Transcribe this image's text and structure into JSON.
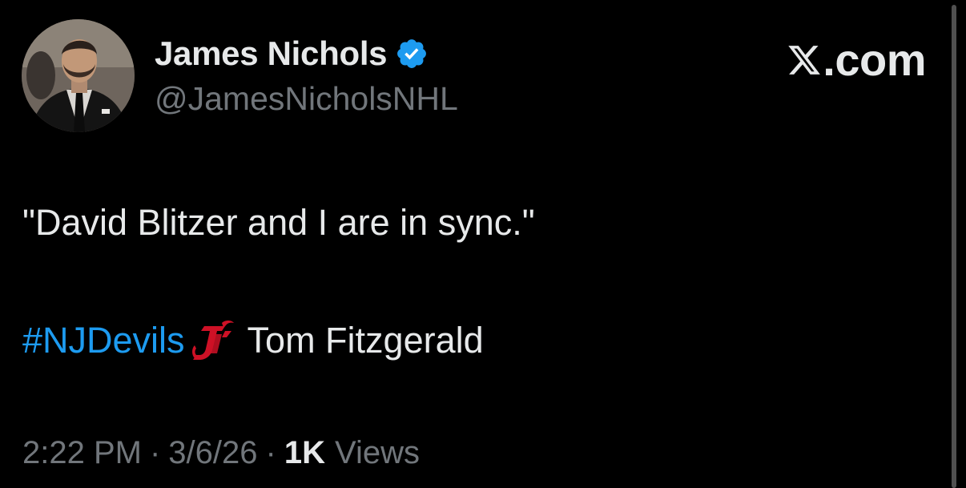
{
  "author": {
    "display_name": "James Nichols",
    "handle": "@JamesNicholsNHL",
    "verified": true,
    "verified_color": "#1d9bf0",
    "avatar_icon": "profile-photo"
  },
  "brand": {
    "logo_icon": "x-logo-icon",
    "text": ".com"
  },
  "tweet": {
    "quote": "\"David Blitzer and I are in sync.\"",
    "hashtag": "#NJDevils",
    "hashtag_color": "#1d9bf0",
    "emoji_icon": "nj-devils-logo-icon",
    "emoji_color": "#ce1126",
    "attribution": "Tom Fitzgerald"
  },
  "meta": {
    "time": "2:22 PM",
    "separator": "·",
    "date": "3/6/26",
    "views_count": "1K",
    "views_label": "Views"
  },
  "colors": {
    "background": "#000000",
    "primary_text": "#e7e9ea",
    "secondary_text": "#71767b"
  }
}
